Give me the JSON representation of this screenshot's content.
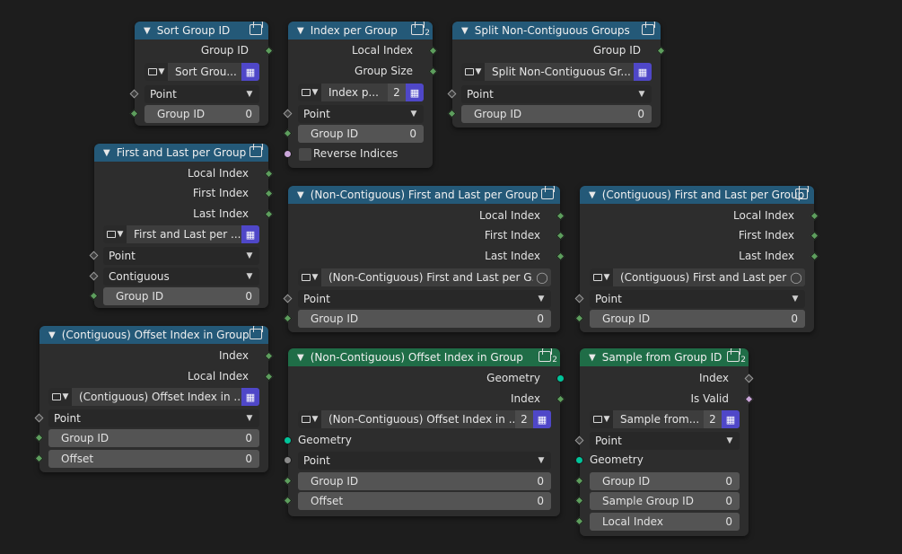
{
  "nodes": {
    "sort_group_id": {
      "title": "Sort Group ID",
      "outputs": [
        "Group ID"
      ],
      "group_name": "Sort Grou...",
      "dropdown": "Point",
      "inputs": [
        {
          "label": "Group ID",
          "value": "0"
        }
      ]
    },
    "index_per_group": {
      "title": "Index per Group",
      "users": "2",
      "outputs": [
        "Local Index",
        "Group Size"
      ],
      "group_name": "Index p...",
      "group_users": "2",
      "dropdown": "Point",
      "inputs": [
        {
          "label": "Group ID",
          "value": "0"
        }
      ],
      "checkbox": "Reverse Indices"
    },
    "split_noncontig": {
      "title": "Split Non-Contiguous Groups",
      "outputs": [
        "Group ID"
      ],
      "group_name": "Split Non-Contiguous Gr...",
      "dropdown": "Point",
      "inputs": [
        {
          "label": "Group ID",
          "value": "0"
        }
      ]
    },
    "first_last": {
      "title": "First and Last per Group",
      "outputs": [
        "Local Index",
        "First Index",
        "Last Index"
      ],
      "group_name": "First and Last per ...",
      "dropdown": "Point",
      "dropdown2": "Contiguous",
      "inputs": [
        {
          "label": "Group ID",
          "value": "0"
        }
      ]
    },
    "noncontig_first_last": {
      "title": "(Non-Contiguous) First and Last per Group",
      "outputs": [
        "Local Index",
        "First Index",
        "Last Index"
      ],
      "group_name": "(Non-Contiguous) First and Last per G...",
      "dropdown": "Point",
      "inputs": [
        {
          "label": "Group ID",
          "value": "0"
        }
      ]
    },
    "contig_first_last": {
      "title": "(Contiguous) First and Last per Group",
      "outputs": [
        "Local Index",
        "First Index",
        "Last Index"
      ],
      "group_name": "(Contiguous) First and Last per ...",
      "dropdown": "Point",
      "inputs": [
        {
          "label": "Group ID",
          "value": "0"
        }
      ]
    },
    "contig_offset": {
      "title": "(Contiguous) Offset Index in Group",
      "outputs": [
        "Index",
        "Local Index"
      ],
      "group_name": "(Contiguous) Offset Index in ...",
      "dropdown": "Point",
      "inputs": [
        {
          "label": "Group ID",
          "value": "0"
        },
        {
          "label": "Offset",
          "value": "0"
        }
      ]
    },
    "noncontig_offset": {
      "title": "(Non-Contiguous) Offset Index in Group",
      "users": "2",
      "outputs": [
        "Geometry",
        "Index"
      ],
      "group_name": "(Non-Contiguous) Offset Index in ...",
      "group_users": "2",
      "geometry_label": "Geometry",
      "dropdown": "Point",
      "inputs": [
        {
          "label": "Group ID",
          "value": "0"
        },
        {
          "label": "Offset",
          "value": "0"
        }
      ]
    },
    "sample_group": {
      "title": "Sample from Group ID",
      "users": "2",
      "outputs": [
        "Index",
        "Is Valid"
      ],
      "group_name": "Sample from...",
      "group_users": "2",
      "dropdown": "Point",
      "geometry_label": "Geometry",
      "inputs": [
        {
          "label": "Group ID",
          "value": "0"
        },
        {
          "label": "Sample Group ID",
          "value": "0"
        },
        {
          "label": "Local Index",
          "value": "0"
        }
      ]
    }
  },
  "colors": {
    "canvas": "#1d1d1d",
    "node_body": "#2d2d2d",
    "header_group": "#245978",
    "header_geometry": "#1f6d47",
    "socket_int": "#5d9e5d",
    "socket_geometry": "#00c49a",
    "socket_bool": "#c9a5d8",
    "fake_user_button": "#4f47c8"
  },
  "icons": [
    "node-group-icon",
    "chevron-down-icon",
    "fake-user-icon",
    "shield-icon"
  ]
}
